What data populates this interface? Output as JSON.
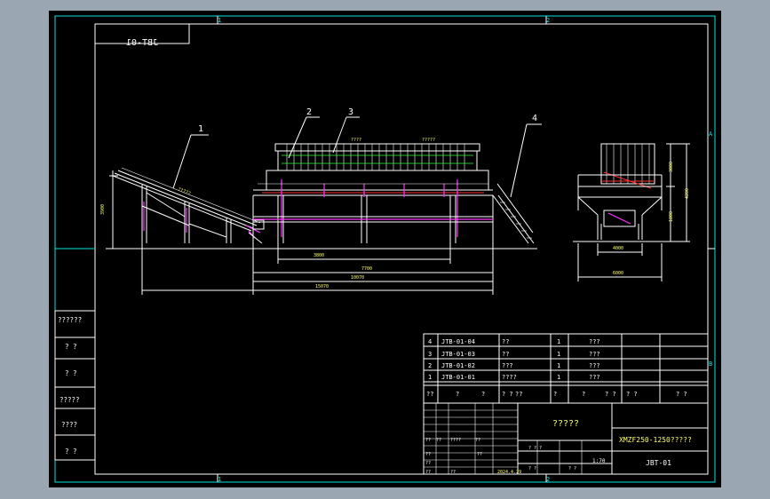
{
  "drawing": {
    "code_mirrored": "JBT-01",
    "grid_marks": {
      "top": [
        "1",
        "2"
      ],
      "bottom": [
        "1",
        "2"
      ],
      "right": [
        "A",
        "B"
      ]
    },
    "leaders": [
      "1",
      "2",
      "3",
      "4"
    ],
    "dimensions": {
      "conveyor_height": "3900",
      "platform_span": "3800",
      "press_length": "7700",
      "total_length": "10070",
      "overall_length": "15070",
      "side_width_inner": "4000",
      "side_width_outer": "6000",
      "side_height_upper": "3000",
      "side_height_lower": "1800",
      "side_height_total": "4200"
    },
    "tag_left": "????",
    "tag_right": "?????",
    "conveyor_label": "?????"
  },
  "left_column": [
    "??????",
    "? ?",
    "? ?",
    "?????",
    "????",
    "? ?"
  ],
  "parts_table": {
    "rows": [
      {
        "no": "4",
        "code": "JTB-01-04",
        "name": "??",
        "qty": "1",
        "note": "???"
      },
      {
        "no": "3",
        "code": "JTB-01-03",
        "name": "??",
        "qty": "1",
        "note": "???"
      },
      {
        "no": "2",
        "code": "JTB-01-02",
        "name": "???",
        "qty": "1",
        "note": "???"
      },
      {
        "no": "1",
        "code": "JTB-01-01",
        "name": "????",
        "qty": "1",
        "note": "???"
      }
    ],
    "header": [
      "??",
      "?",
      "?",
      "? ?",
      "??",
      "?",
      "?",
      "? ?",
      "? ?",
      "? ?"
    ]
  },
  "title_block": {
    "center_title": "?????",
    "product": "XMZF250-1250?????",
    "drawing_no": "JBT-01",
    "scale": "1:70",
    "date": "2024.4.29",
    "sign_cells": [
      "??",
      "??",
      "????",
      "??",
      "??",
      "??",
      "??",
      "??",
      "??"
    ],
    "misc": [
      "? ? ?",
      "? ?",
      "? ?"
    ]
  }
}
